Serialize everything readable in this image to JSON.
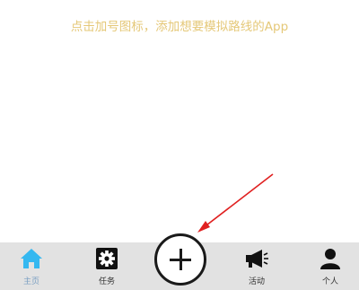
{
  "hint_text": "点击加号图标，添加想要模拟路线的App",
  "colors": {
    "hint": "#e5c878",
    "tabbar_bg": "#e2e2e2",
    "active_icon": "#35b8f0",
    "arrow": "#e02020"
  },
  "tabbar": {
    "tabs": [
      {
        "label": "主页",
        "icon": "home-icon",
        "active": true
      },
      {
        "label": "任务",
        "icon": "gear-icon",
        "active": false
      },
      {
        "label": "",
        "icon": "plus-icon",
        "active": false
      },
      {
        "label": "活动",
        "icon": "megaphone-icon",
        "active": false
      },
      {
        "label": "个人",
        "icon": "person-icon",
        "active": false
      }
    ]
  }
}
